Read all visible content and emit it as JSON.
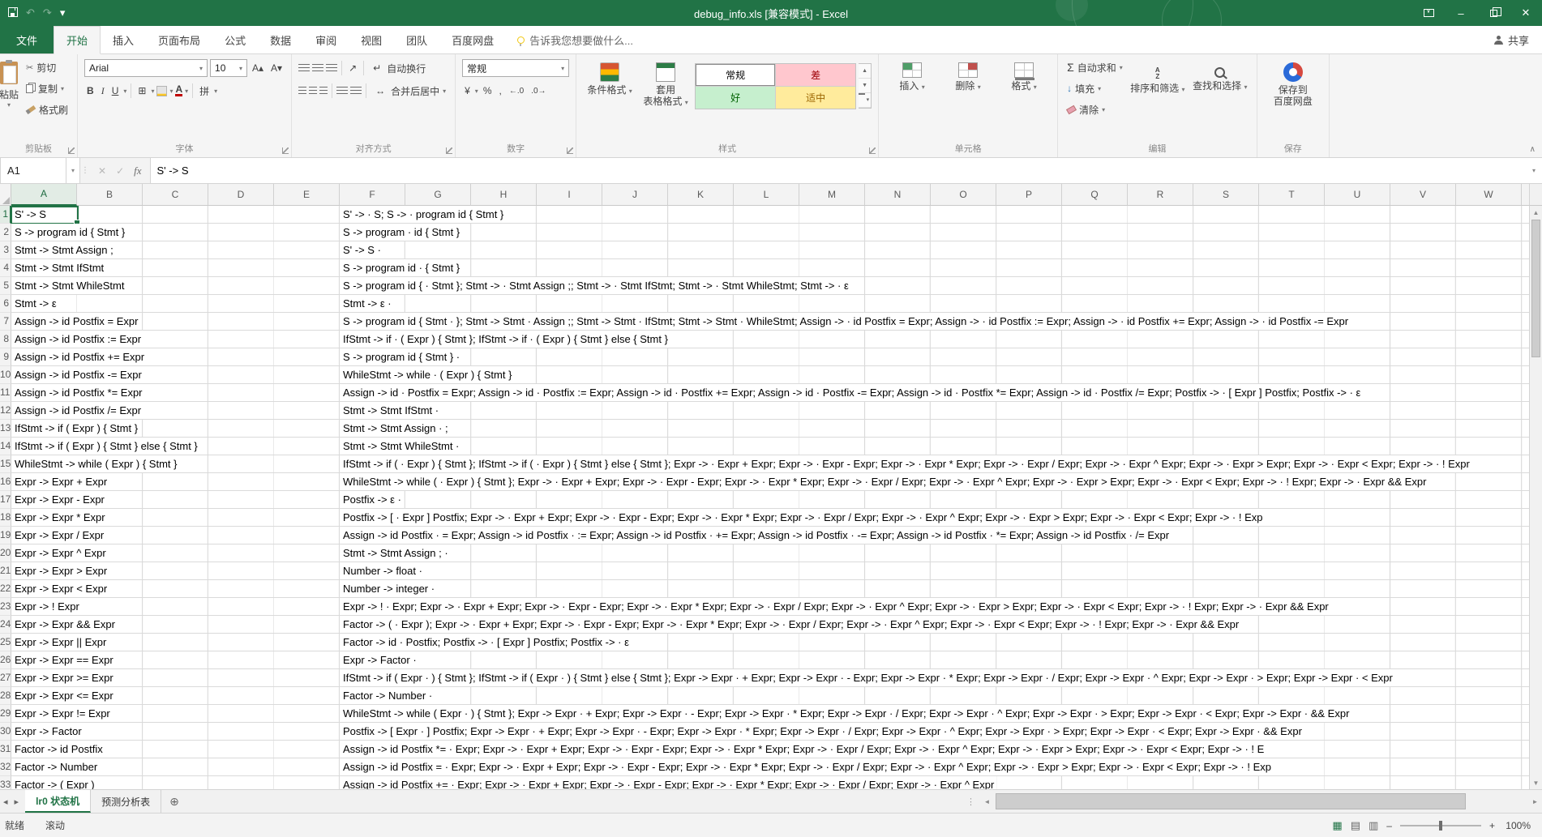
{
  "window": {
    "title": "debug_info.xls  [兼容模式] - Excel"
  },
  "icons": {
    "dropdown": "▾",
    "undo": "↶",
    "redo": "↷",
    "close": "✕",
    "minimize": "–",
    "scissors": "✂",
    "bold": "B",
    "italic": "I",
    "underline": "U",
    "borders": "⊞",
    "sigma": "Σ",
    "currency": "¥",
    "percent": "%",
    "comma": ",",
    "inc_decimal": "←.0",
    "dec_decimal": ".0→",
    "grow_font": "A▴",
    "shrink_font": "A▾",
    "wrap_arrow": "↵",
    "merge_arrow": "↔",
    "orient": "↗",
    "fill_down": "↓",
    "up": "▲",
    "down": "▼",
    "left": "◄",
    "right": "►",
    "tri_left": "◂",
    "tri_right": "▸",
    "new_sheet": "⊕",
    "collapse": "∧",
    "splitter": "⋮",
    "view_normal": "▦",
    "view_layout": "▤",
    "view_break": "▥",
    "fx": "fx",
    "cancel": "✕",
    "enter": "✓",
    "phonetic": "拼",
    "sort_a": "A",
    "sort_z": "Z"
  },
  "ribbon_tabs": [
    {
      "id": "file",
      "label": "文件",
      "file": true
    },
    {
      "id": "home",
      "label": "开始",
      "active": true
    },
    {
      "id": "insert",
      "label": "插入"
    },
    {
      "id": "page-layout",
      "label": "页面布局"
    },
    {
      "id": "formulas",
      "label": "公式"
    },
    {
      "id": "data",
      "label": "数据"
    },
    {
      "id": "review",
      "label": "审阅"
    },
    {
      "id": "view",
      "label": "视图"
    },
    {
      "id": "team",
      "label": "团队"
    },
    {
      "id": "baidu-netdisk",
      "label": "百度网盘"
    }
  ],
  "tell_me": "告诉我您想要做什么...",
  "share": "共享",
  "ribbon": {
    "clipboard": {
      "label": "剪贴板",
      "paste": "粘贴",
      "cut": "剪切",
      "copy": "复制",
      "painter": "格式刷"
    },
    "font": {
      "label": "字体",
      "family": "Arial",
      "size": "10"
    },
    "alignment": {
      "label": "对齐方式",
      "wrap": "自动换行",
      "merge": "合并后居中"
    },
    "number": {
      "label": "数字",
      "format": "常规"
    },
    "styles": {
      "label": "样式",
      "conditional": "条件格式",
      "format_table": "套用\n表格格式",
      "gallery": [
        {
          "label": "常规",
          "bg": "#ffffff",
          "fg": "#000000",
          "selected": true
        },
        {
          "label": "差",
          "bg": "#ffc7ce",
          "fg": "#9c0006"
        },
        {
          "label": "好",
          "bg": "#c6efce",
          "fg": "#006100"
        },
        {
          "label": "适中",
          "bg": "#ffeb9c",
          "fg": "#9c6500"
        }
      ]
    },
    "cells": {
      "label": "单元格",
      "insert": "插入",
      "delete": "删除",
      "format": "格式"
    },
    "editing": {
      "label": "编辑",
      "autosum": "自动求和",
      "fill": "填充",
      "clear": "清除",
      "sort": "排序和筛选",
      "find": "查找和选择"
    },
    "save_group": {
      "label": "保存",
      "baidu": "保存到\n百度网盘"
    }
  },
  "formula_bar": {
    "name_box": "A1",
    "formula": "S' -> S"
  },
  "grid": {
    "columns": [
      "A",
      "B",
      "C",
      "D",
      "E",
      "F",
      "G",
      "H",
      "I",
      "J",
      "K",
      "L",
      "M",
      "N",
      "O",
      "P",
      "Q",
      "R",
      "S",
      "T",
      "U",
      "V",
      "W"
    ],
    "selected_column": "A",
    "selected_row": "1",
    "rows": [
      {
        "n": "1",
        "a": "S' -> S",
        "f": "S' -> · S; S -> · program id { Stmt }"
      },
      {
        "n": "2",
        "a": "S -> program id { Stmt }",
        "f": "S -> program · id { Stmt }"
      },
      {
        "n": "3",
        "a": "Stmt -> Stmt Assign ;",
        "f": "S' -> S ·"
      },
      {
        "n": "4",
        "a": "Stmt -> Stmt IfStmt",
        "f": "S -> program id · { Stmt }"
      },
      {
        "n": "5",
        "a": "Stmt -> Stmt WhileStmt",
        "f": "S -> program id { · Stmt }; Stmt -> · Stmt Assign ;; Stmt -> · Stmt IfStmt; Stmt -> · Stmt WhileStmt; Stmt -> · ε"
      },
      {
        "n": "6",
        "a": "Stmt -> ε",
        "f": "Stmt -> ε ·"
      },
      {
        "n": "7",
        "a": "Assign -> id Postfix = Expr",
        "f": "S -> program id { Stmt · }; Stmt -> Stmt · Assign ;; Stmt -> Stmt · IfStmt; Stmt -> Stmt · WhileStmt; Assign -> · id Postfix = Expr; Assign -> · id Postfix := Expr; Assign -> · id Postfix += Expr; Assign -> · id Postfix -= Expr"
      },
      {
        "n": "8",
        "a": "Assign -> id Postfix := Expr",
        "f": "IfStmt -> if · ( Expr ) { Stmt }; IfStmt -> if · ( Expr ) { Stmt } else { Stmt }"
      },
      {
        "n": "9",
        "a": "Assign -> id Postfix += Expr",
        "f": "S -> program id { Stmt } ·"
      },
      {
        "n": "10",
        "a": "Assign -> id Postfix -= Expr",
        "f": "WhileStmt -> while · ( Expr ) { Stmt }"
      },
      {
        "n": "11",
        "a": "Assign -> id Postfix *= Expr",
        "f": "Assign -> id · Postfix = Expr; Assign -> id · Postfix := Expr; Assign -> id · Postfix += Expr; Assign -> id · Postfix -= Expr; Assign -> id · Postfix *= Expr; Assign -> id · Postfix /= Expr; Postfix -> · [ Expr ] Postfix; Postfix -> · ε"
      },
      {
        "n": "12",
        "a": "Assign -> id Postfix /= Expr",
        "f": "Stmt -> Stmt IfStmt ·"
      },
      {
        "n": "13",
        "a": "IfStmt -> if ( Expr ) { Stmt }",
        "f": "Stmt -> Stmt Assign · ;"
      },
      {
        "n": "14",
        "a": "IfStmt -> if ( Expr ) { Stmt } else { Stmt }",
        "f": "Stmt -> Stmt WhileStmt ·"
      },
      {
        "n": "15",
        "a": "WhileStmt -> while ( Expr ) { Stmt }",
        "f": "IfStmt -> if ( · Expr ) { Stmt }; IfStmt -> if ( · Expr ) { Stmt } else { Stmt }; Expr -> · Expr + Expr; Expr -> · Expr - Expr; Expr -> · Expr * Expr; Expr -> · Expr / Expr; Expr -> · Expr ^ Expr; Expr -> · Expr > Expr; Expr -> · Expr < Expr; Expr -> · ! Expr"
      },
      {
        "n": "16",
        "a": "Expr -> Expr + Expr",
        "f": "WhileStmt -> while ( · Expr ) { Stmt }; Expr -> · Expr + Expr; Expr -> · Expr - Expr; Expr -> · Expr * Expr; Expr -> · Expr / Expr; Expr -> · Expr ^ Expr; Expr -> · Expr > Expr; Expr -> · Expr < Expr; Expr -> · ! Expr; Expr -> · Expr && Expr"
      },
      {
        "n": "17",
        "a": "Expr -> Expr - Expr",
        "f": "Postfix -> ε ·"
      },
      {
        "n": "18",
        "a": "Expr -> Expr * Expr",
        "f": "Postfix -> [ · Expr ] Postfix; Expr -> · Expr + Expr; Expr -> · Expr - Expr; Expr -> · Expr * Expr; Expr -> · Expr / Expr; Expr -> · Expr ^ Expr; Expr -> · Expr > Expr; Expr -> · Expr < Expr; Expr -> · ! Exp"
      },
      {
        "n": "19",
        "a": "Expr -> Expr / Expr",
        "f": "Assign -> id Postfix · = Expr; Assign -> id Postfix · := Expr; Assign -> id Postfix · += Expr; Assign -> id Postfix · -= Expr; Assign -> id Postfix · *= Expr; Assign -> id Postfix · /= Expr"
      },
      {
        "n": "20",
        "a": "Expr -> Expr ^ Expr",
        "f": "Stmt -> Stmt Assign ; ·"
      },
      {
        "n": "21",
        "a": "Expr -> Expr > Expr",
        "f": "Number -> float ·"
      },
      {
        "n": "22",
        "a": "Expr -> Expr < Expr",
        "f": "Number -> integer ·"
      },
      {
        "n": "23",
        "a": "Expr -> ! Expr",
        "f": "Expr -> ! · Expr; Expr -> · Expr + Expr; Expr -> · Expr - Expr; Expr -> · Expr * Expr; Expr -> · Expr / Expr; Expr -> · Expr ^ Expr; Expr -> · Expr > Expr; Expr -> · Expr < Expr; Expr -> · ! Expr; Expr -> · Expr && Expr"
      },
      {
        "n": "24",
        "a": "Expr -> Expr && Expr",
        "f": "Factor -> ( · Expr ); Expr -> · Expr + Expr; Expr -> · Expr - Expr; Expr -> · Expr * Expr; Expr -> · Expr / Expr; Expr -> · Expr ^ Expr; Expr -> · Expr < Expr; Expr -> · ! Expr; Expr -> · Expr && Expr"
      },
      {
        "n": "25",
        "a": "Expr -> Expr || Expr",
        "f": "Factor -> id · Postfix; Postfix -> · [ Expr ] Postfix; Postfix -> · ε"
      },
      {
        "n": "26",
        "a": "Expr -> Expr == Expr",
        "f": "Expr -> Factor ·"
      },
      {
        "n": "27",
        "a": "Expr -> Expr >= Expr",
        "f": "IfStmt -> if ( Expr · ) { Stmt }; IfStmt -> if ( Expr · ) { Stmt } else { Stmt }; Expr -> Expr · + Expr; Expr -> Expr · - Expr; Expr -> Expr · * Expr; Expr -> Expr · / Expr; Expr -> Expr · ^ Expr; Expr -> Expr · > Expr; Expr -> Expr · < Expr"
      },
      {
        "n": "28",
        "a": "Expr -> Expr <= Expr",
        "f": "Factor -> Number ·"
      },
      {
        "n": "29",
        "a": "Expr -> Expr != Expr",
        "f": "WhileStmt -> while ( Expr · ) { Stmt }; Expr -> Expr · + Expr; Expr -> Expr · - Expr; Expr -> Expr · * Expr; Expr -> Expr · / Expr; Expr -> Expr · ^ Expr; Expr -> Expr · > Expr; Expr -> Expr · < Expr; Expr -> Expr · && Expr"
      },
      {
        "n": "30",
        "a": "Expr -> Factor",
        "f": "Postfix -> [ Expr · ] Postfix; Expr -> Expr · + Expr; Expr -> Expr · - Expr; Expr -> Expr · * Expr; Expr -> Expr · / Expr; Expr -> Expr · ^ Expr; Expr -> Expr · > Expr; Expr -> Expr · < Expr; Expr -> Expr · && Expr"
      },
      {
        "n": "31",
        "a": "Factor -> id Postfix",
        "f": "Assign -> id Postfix *= · Expr; Expr -> · Expr + Expr; Expr -> · Expr - Expr; Expr -> · Expr * Expr; Expr -> · Expr / Expr; Expr -> · Expr ^ Expr; Expr -> · Expr > Expr; Expr -> · Expr < Expr; Expr -> · ! E"
      },
      {
        "n": "32",
        "a": "Factor -> Number",
        "f": "Assign -> id Postfix = · Expr; Expr -> · Expr + Expr; Expr -> · Expr - Expr; Expr -> · Expr * Expr; Expr -> · Expr / Expr; Expr -> · Expr ^ Expr; Expr -> · Expr > Expr; Expr -> · Expr < Expr; Expr -> · ! Exp"
      },
      {
        "n": "33",
        "a": "Factor -> ( Expr )",
        "f": "Assign -> id Postfix += · Expr; Expr -> · Expr + Expr; Expr -> · Expr - Expr; Expr -> · Expr * Expr; Expr -> · Expr / Expr; Expr -> · Expr ^ Expr"
      }
    ]
  },
  "sheet_tabs": [
    {
      "label": "lr0 状态机",
      "active": true
    },
    {
      "label": "预测分析表",
      "active": false
    }
  ],
  "status_bar": {
    "ready": "就绪",
    "scroll": "滚动",
    "zoom": "100%"
  },
  "colors": {
    "accent": "#217346",
    "bad_bg": "#ffc7ce",
    "good_bg": "#c6efce",
    "neutral_bg": "#ffeb9c"
  }
}
